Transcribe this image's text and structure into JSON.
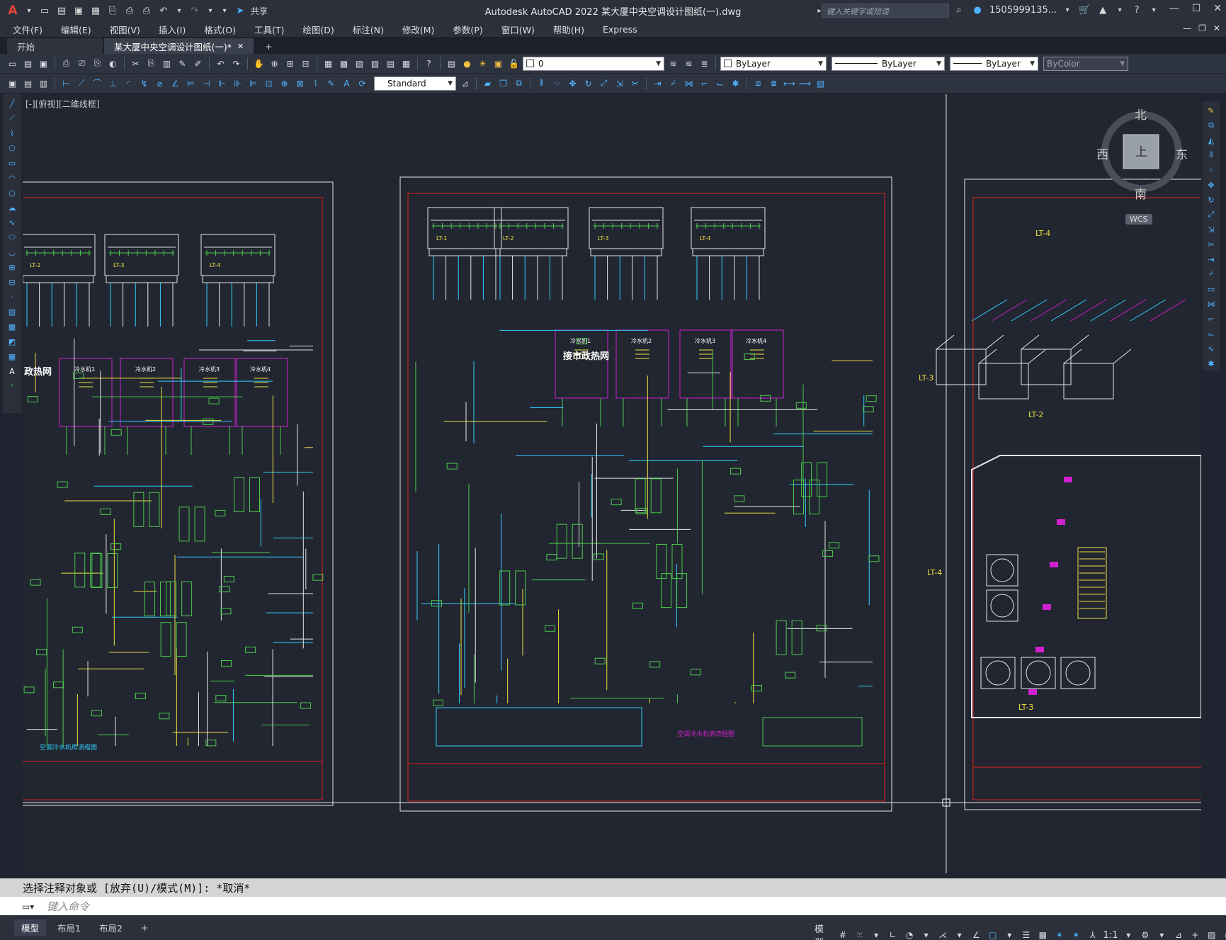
{
  "app": {
    "title": "Autodesk AutoCAD 2022    某大厦中央空调设计图纸(一).dwg",
    "search_placeholder": "键入关键字或短语",
    "user": "1505999135...",
    "share_label": "共享"
  },
  "menu": {
    "items": [
      "文件(F)",
      "编辑(E)",
      "视图(V)",
      "插入(I)",
      "格式(O)",
      "工具(T)",
      "绘图(D)",
      "标注(N)",
      "修改(M)",
      "参数(P)",
      "窗口(W)",
      "帮助(H)",
      "Express"
    ]
  },
  "tabs": {
    "start": "开始",
    "document": "某大厦中央空调设计图纸(一)*"
  },
  "toolbar": {
    "layer_value": "0",
    "color_value": "ByLayer",
    "linetype_value": "ByLayer",
    "lineweight_value": "ByLayer",
    "plotstyle_value": "ByColor",
    "textstyle_value": "Standard"
  },
  "viewport": {
    "label": "[-][俯视][二维线框]"
  },
  "viewcube": {
    "north": "北",
    "south": "南",
    "east": "东",
    "west": "西",
    "top": "上",
    "wcs": "WCS"
  },
  "drawing": {
    "sheet1": {
      "units": [
        "LT-2",
        "LT-3",
        "LT-4"
      ],
      "pumps": [
        "冷水机1",
        "冷水机2",
        "冷水机3",
        "冷水机4"
      ],
      "label_left": "政热网",
      "caption": "空调冷水机房流程图"
    },
    "sheet2": {
      "units": [
        "LT-1",
        "LT-2",
        "LT-3",
        "LT-4"
      ],
      "pumps": [
        "冷水机1",
        "冷水机2",
        "冷水机3",
        "冷水机4"
      ],
      "label": "接市政热网",
      "caption": "空调冷水机房流程图"
    },
    "sheet3": {
      "labels": [
        "LT-4",
        "LT-3",
        "LT-2",
        "LT-4",
        "LT-3"
      ]
    }
  },
  "command": {
    "history": "选择注释对象或 [放弃(U)/模式(M)]: *取消*",
    "placeholder": "键入命令"
  },
  "status": {
    "layout_tabs": [
      "模型",
      "布局1",
      "布局2"
    ],
    "model_label": "模型",
    "scale": "1:1"
  }
}
